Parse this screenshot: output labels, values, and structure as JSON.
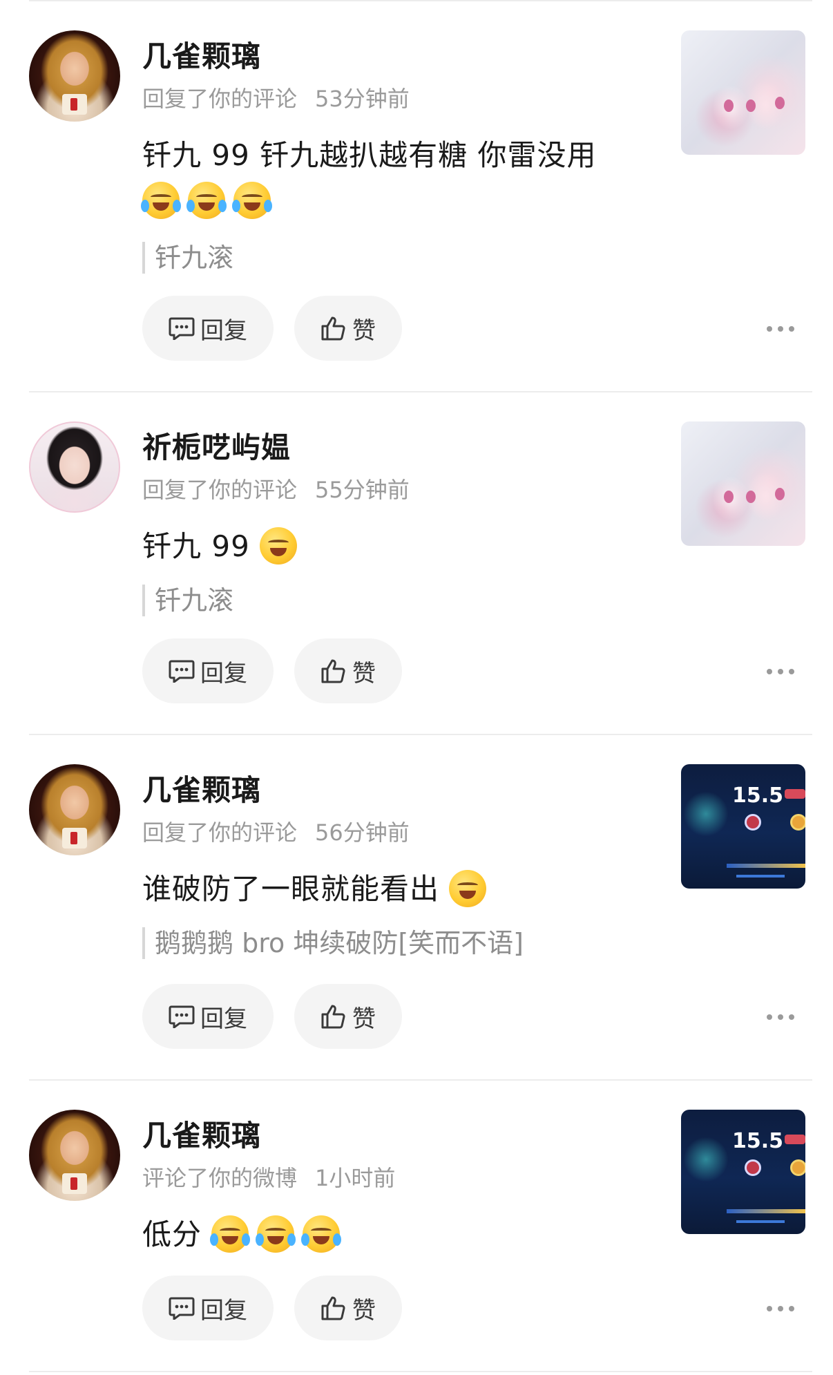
{
  "items": [
    {
      "name": "几雀颗璃",
      "action": "回复了你的评论",
      "time": "53分钟前",
      "text": "钎九 99 钎九越扒越有糖 你雷没用",
      "quote": "钎九滚",
      "avatar": "blonde-portrait",
      "thumb": "anime-girls"
    },
    {
      "name": "祈栀呓屿媪",
      "action": "回复了你的评论",
      "time": "55分钟前",
      "text": "钎九 99",
      "quote": "钎九滚",
      "avatar": "girl-portrait",
      "thumb": "anime-girls"
    },
    {
      "name": "几雀颗璃",
      "action": "回复了你的评论",
      "time": "56分钟前",
      "text": "谁破防了一眼就能看出",
      "quote": "鹅鹅鹅 bro 坤续破防[笑而不语]",
      "avatar": "blonde-portrait",
      "thumb": "game-score"
    },
    {
      "name": "几雀颗璃",
      "action": "评论了你的微博",
      "time": "1小时前",
      "text": "低分",
      "quote": "",
      "avatar": "blonde-portrait",
      "thumb": "game-score"
    }
  ],
  "buttons": {
    "reply": "回复",
    "like": "赞"
  },
  "game_thumb": {
    "score": "15.5"
  },
  "icons": {
    "reply": "comment-icon",
    "like": "thumbs-up-icon",
    "more": "more-icon",
    "emoji_cry": "crying-laugh-emoji",
    "emoji_laugh": "laughing-emoji",
    "emoji_shy": "covering-mouth-emoji"
  },
  "colors": {
    "meta": "#9a9a9a",
    "button_bg": "#f4f4f4",
    "divider": "#ececec"
  }
}
